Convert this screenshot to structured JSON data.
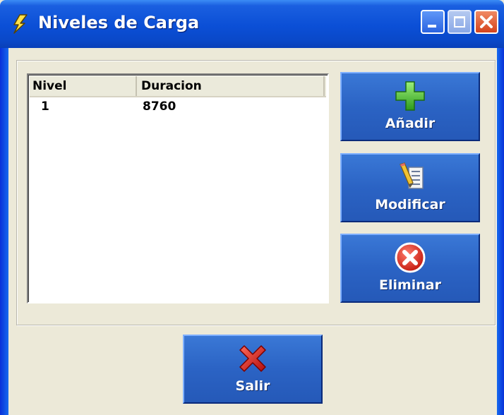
{
  "window": {
    "title": "Niveles de Carga",
    "icon": "lightning-icon",
    "controls": [
      "minimize-icon",
      "maximize-icon",
      "close-icon"
    ]
  },
  "list": {
    "columns": [
      "Nivel",
      "Duracion"
    ],
    "rows": [
      {
        "nivel": "1",
        "duracion": "8760"
      }
    ]
  },
  "buttons": {
    "add": {
      "label": "Añadir",
      "icon": "plus-icon"
    },
    "modify": {
      "label": "Modificar",
      "icon": "edit-pencil-icon"
    },
    "delete": {
      "label": "Eliminar",
      "icon": "error-circle-x-icon"
    },
    "exit": {
      "label": "Salir",
      "icon": "red-x-icon"
    }
  },
  "colors": {
    "titlebar": "#0b4fd6",
    "button_face": "#2b63c4",
    "dialog_bg": "#ece9d8"
  }
}
